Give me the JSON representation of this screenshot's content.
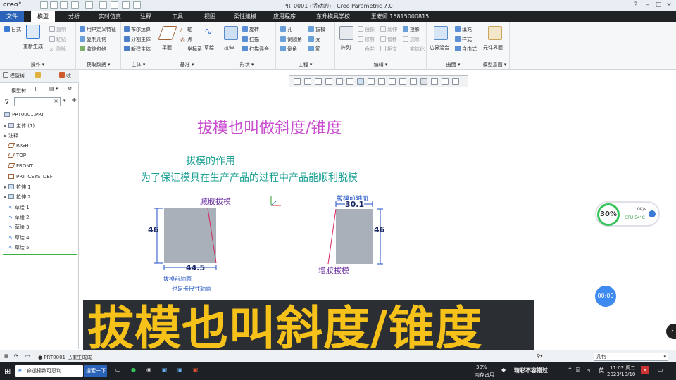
{
  "window": {
    "app_logo": "creo°",
    "title": "PRT0001 (活动的) - Creo Parametric 7.0"
  },
  "menu": {
    "tabs": [
      "文件",
      "模型",
      "分析",
      "实时仿真",
      "注释",
      "工具",
      "视图",
      "柔性建模",
      "应用程序",
      "东升模具学校",
      "王老师 15815000815"
    ],
    "active": "模型"
  },
  "ribbon": {
    "groups": [
      {
        "label": "操作 ▾",
        "items": [
          "重新生成",
          "复制",
          "粘贴",
          "删除"
        ]
      },
      {
        "label": "获取数据 ▾",
        "items": [
          "用户定义特征",
          "复制几何",
          "收缩包络"
        ]
      },
      {
        "label": "主体 ▾",
        "items": [
          "布尔运算",
          "分割主体",
          "新建主体"
        ]
      },
      {
        "label": "基准 ▾",
        "items": [
          "平面",
          "轴",
          "点",
          "坐标系",
          "草绘"
        ]
      },
      {
        "label": "形状 ▾",
        "items": [
          "拉伸",
          "旋转",
          "扫描",
          "扫描混合"
        ]
      },
      {
        "label": "工程 ▾",
        "items": [
          "孔",
          "倒圆角",
          "倒角",
          "拔模",
          "壳",
          "筋"
        ]
      },
      {
        "label": "编辑 ▾",
        "items": [
          "阵列",
          "镜像",
          "修剪",
          "合并",
          "延伸",
          "偏移",
          "相交",
          "投影",
          "加厚",
          "实体化"
        ]
      },
      {
        "label": "曲面 ▾",
        "items": [
          "边界混合",
          "填充",
          "样式",
          "自由式"
        ]
      },
      {
        "label": "模型意图 ▾",
        "items": [
          "元件界面"
        ]
      }
    ]
  },
  "left_panel": {
    "tabs": [
      "模型树",
      "",
      "收"
    ],
    "toolbar_label": "模型树",
    "tree": [
      {
        "label": "PRT0001.PRT",
        "expand": ""
      },
      {
        "label": "主体 (1)",
        "expand": "▸"
      },
      {
        "label": "注释",
        "expand": "▸"
      },
      {
        "label": "RIGHT",
        "expand": ""
      },
      {
        "label": "TOP",
        "expand": ""
      },
      {
        "label": "FRONT",
        "expand": ""
      },
      {
        "label": "PRT_CSYS_DEF",
        "expand": ""
      },
      {
        "label": "拉伸 1",
        "expand": "▸"
      },
      {
        "label": "拉伸 2",
        "expand": "▸"
      },
      {
        "label": "草绘 1",
        "expand": ""
      },
      {
        "label": "草绘 2",
        "expand": ""
      },
      {
        "label": "草绘 3",
        "expand": ""
      },
      {
        "label": "草绘 4",
        "expand": ""
      },
      {
        "label": "草绘 5",
        "expand": ""
      }
    ]
  },
  "canvas": {
    "title": "拔模也叫做斜度/锥度",
    "purpose_heading": "拔模的作用",
    "purpose_text": "为了保证模具在生产产品的过程中产品能顺利脱模",
    "left_label": "减胶拔模",
    "left_height": "46",
    "left_width": "44.5",
    "left_note1": "拔模前轴面",
    "left_note2": "也是卡尺寸轴面",
    "right_label_top": "拔模前轴面",
    "right_width": "30.1",
    "right_height": "46",
    "right_label_bottom": "增胶拔模"
  },
  "widgets": {
    "cpu_percent": "30%",
    "net_speed": "0K/s",
    "cpu_label": "CPU 54°C",
    "timer": "00:00"
  },
  "caption": "拔模也叫斜度/锥度",
  "status": {
    "message": "● PRT0001 已重生成成",
    "filter_value": "几何"
  },
  "taskbar": {
    "search_text": "穿透棉数可忍利",
    "search_button": "搜索一下",
    "mem_percent": "30%",
    "mem_label": "内存占用",
    "news": "精彩不容错过",
    "ime": "英",
    "time": "11:02 周二",
    "date": "2023/10/10"
  },
  "colors": {
    "title_purple": "#c94fd0",
    "teal": "#1aa093",
    "dim_purple": "#6a2fa0",
    "dim_blue": "#1d4fc4",
    "block_gray": "#a9b0b9",
    "caption_yellow": "#f6c21a"
  }
}
